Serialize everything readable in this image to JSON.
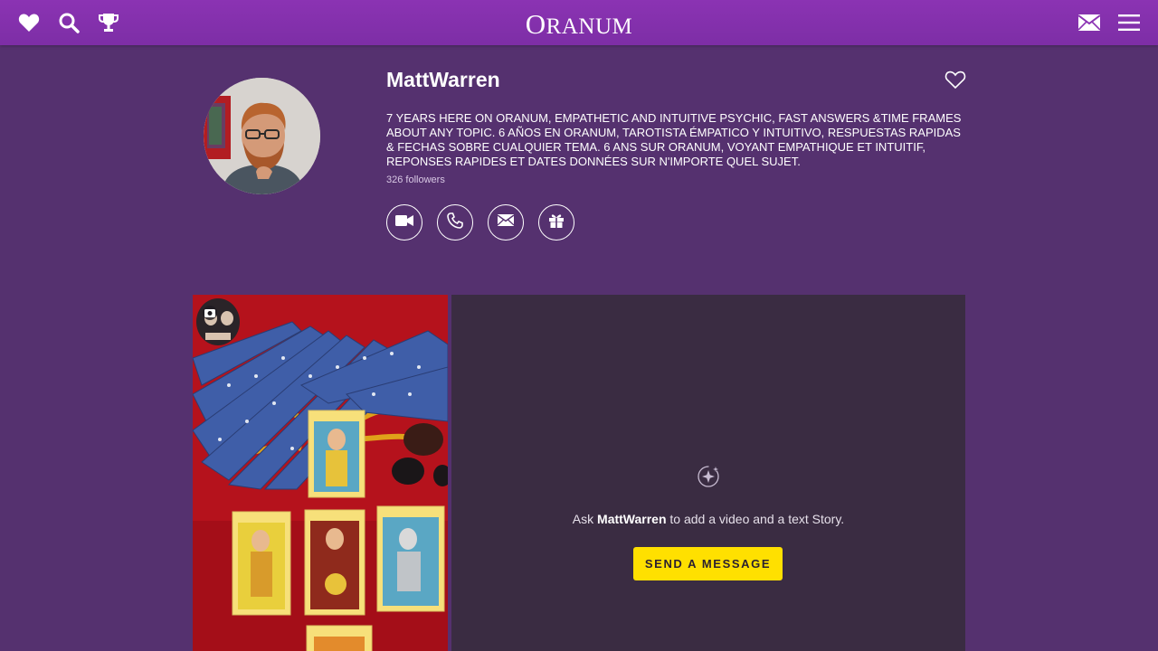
{
  "header": {
    "logo_initial": "O",
    "logo_rest": "RANUM",
    "icons_left": [
      "heart-icon",
      "search-icon",
      "trophy-icon"
    ],
    "icons_right": [
      "envelope-icon",
      "menu-icon"
    ]
  },
  "profile": {
    "name": "MattWarren",
    "bio": "7 YEARS HERE ON ORANUM, EMPATHETIC AND INTUITIVE PSYCHIC, FAST ANSWERS &TIME FRAMES ABOUT ANY TOPIC. 6 AÑOS EN ORANUM, TAROTISTA ÉMPATICO Y INTUITIVO, RESPUESTAS RAPIDAS & FECHAS SOBRE CUALQUIER TEMA. 6 ANS SUR ORANUM, VOYANT EMPATHIQUE ET INTUITIF, REPONSES RAPIDES ET DATES DONNÉES SUR N'IMPORTE QUEL SUJET.",
    "followers": "326 followers",
    "actions": [
      "video-call-icon",
      "phone-icon",
      "message-icon",
      "gift-icon"
    ]
  },
  "story": {
    "ask_prefix": "Ask ",
    "ask_name": "MattWarren",
    "ask_suffix": " to add a video and a text Story.",
    "button_label": "SEND A MESSAGE"
  },
  "colors": {
    "background": "#55316f",
    "header": "#8b33b3",
    "story_panel": "#3a2c42",
    "accent_button": "#ffe000"
  }
}
